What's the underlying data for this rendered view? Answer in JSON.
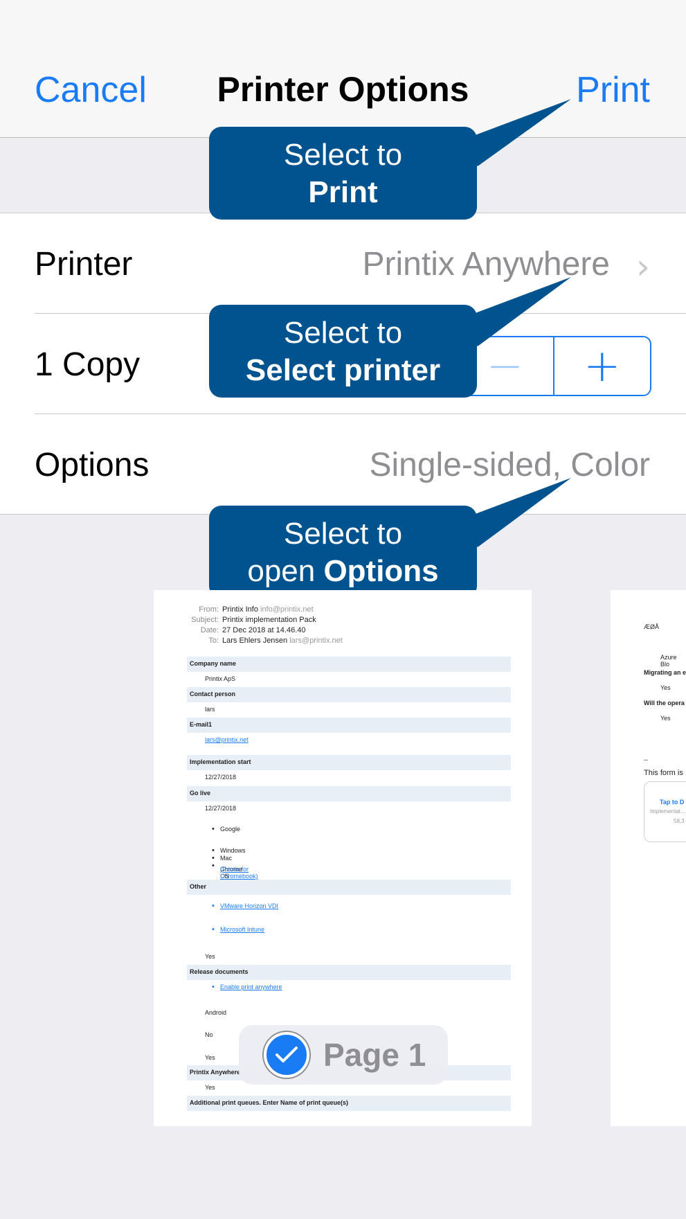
{
  "navbar": {
    "cancel_label": "Cancel",
    "title": "Printer Options",
    "print_label": "Print"
  },
  "settings": {
    "printer": {
      "label": "Printer",
      "value": "Printix Anywhere"
    },
    "copies": {
      "label": "1 Copy",
      "minus": "−",
      "plus": "+"
    },
    "options": {
      "label": "Options",
      "value": "Single-sided, Color"
    }
  },
  "callouts": {
    "print": {
      "line1": "Select to",
      "line2_bold": "Print"
    },
    "printer": {
      "line1": "Select to",
      "line2_bold": "Select printer"
    },
    "options": {
      "line1": "Select to",
      "line2_plain": "open ",
      "line2_bold": "Options"
    }
  },
  "preview": {
    "header": {
      "from_key": "From:",
      "from_name": "Printix Info",
      "from_email": "info@printix.net",
      "subject_key": "Subject:",
      "subject": "Printix implementation Pack",
      "date_key": "Date:",
      "date": "27 Dec 2018 at 14.46.40",
      "to_key": "To:",
      "to_name": "Lars Ehlers Jensen",
      "to_email": "lars@printix.net"
    },
    "rows": {
      "company_name": "Company name",
      "company_value": "Printix ApS",
      "contact_person": "Contact person",
      "contact_value": "lars",
      "email": "E-mail1",
      "email_value": "lars@printix.net",
      "impl_start": "Implementation start",
      "impl_value": "12/27/2018",
      "go_live": "Go live",
      "go_live_value": "12/27/2018",
      "google": "Google",
      "windows": "Windows",
      "mac": "Mac",
      "chrome": "Chrome OS",
      "chrome_link": "(Printix for Chromebook)",
      "other": "Other",
      "vmware": "VMware Horizon VDI",
      "intune": "Microsoft Intune",
      "yes1": "Yes",
      "release_docs": "Release documents",
      "enable_anywhere": "Enable print anywhere",
      "android": "Android",
      "no": "No",
      "yes2": "Yes",
      "printix_anywhere": "Printix Anywhere",
      "yes3": "Yes",
      "additional": "Additional print queues. Enter Name of print queue(s)"
    },
    "side_page": {
      "aeoa": "ÆØÅ",
      "azure": "Azure Blo",
      "migrating": "Migrating an e",
      "yes_a": "Yes",
      "will_opera": "Will the opera",
      "yes_b": "Yes",
      "dashes": "--",
      "form_is": "This form is",
      "tap_to": "Tap to D",
      "implementat": "Implementat...",
      "size": "58,3"
    },
    "page_badge": "Page 1"
  },
  "colors": {
    "ios_blue": "#1a7cf5",
    "callout_bg": "#00538e",
    "secondary_text": "#8e8e93",
    "background": "#ededf2"
  }
}
